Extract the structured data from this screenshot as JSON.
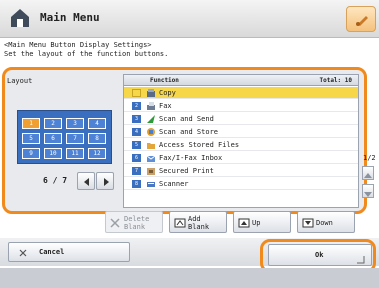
{
  "window": {
    "title": "Main Menu"
  },
  "instructions": {
    "line1": "<Main Menu Button Display Settings>",
    "line2": "Set the layout of the function buttons."
  },
  "layout": {
    "label": "Layout",
    "cells": [
      "1",
      "2",
      "3",
      "4",
      "5",
      "6",
      "7",
      "8",
      "9",
      "10",
      "11",
      "12"
    ],
    "selected_cell": "1",
    "page_indicator": "6 / 7"
  },
  "list": {
    "header_function": "Function",
    "header_total": "Total: 10",
    "items": [
      {
        "num": "",
        "label": "Copy",
        "icon": "copy-icon",
        "selected": true
      },
      {
        "num": "2",
        "label": "Fax",
        "icon": "fax-icon",
        "selected": false
      },
      {
        "num": "3",
        "label": "Scan and Send",
        "icon": "scan-send-icon",
        "selected": false
      },
      {
        "num": "4",
        "label": "Scan and Store",
        "icon": "scan-store-icon",
        "selected": false
      },
      {
        "num": "5",
        "label": "Access Stored Files",
        "icon": "stored-files-icon",
        "selected": false
      },
      {
        "num": "6",
        "label": "Fax/I-Fax Inbox",
        "icon": "inbox-icon",
        "selected": false
      },
      {
        "num": "7",
        "label": "Secured Print",
        "icon": "secured-print-icon",
        "selected": false
      },
      {
        "num": "8",
        "label": "Scanner",
        "icon": "scanner-icon",
        "selected": false
      }
    ],
    "page_count": "1/2"
  },
  "actions": {
    "delete_blank": "Delete\nBlank",
    "add_blank": "Add\nBlank",
    "up": "Up",
    "down": "Down"
  },
  "footer": {
    "cancel": "Cancel",
    "ok": "Ok"
  },
  "colors": {
    "highlight_orange": "#f08a1c",
    "selected_row": "#f6d74a",
    "grid_blue": "#3a6fc0"
  }
}
